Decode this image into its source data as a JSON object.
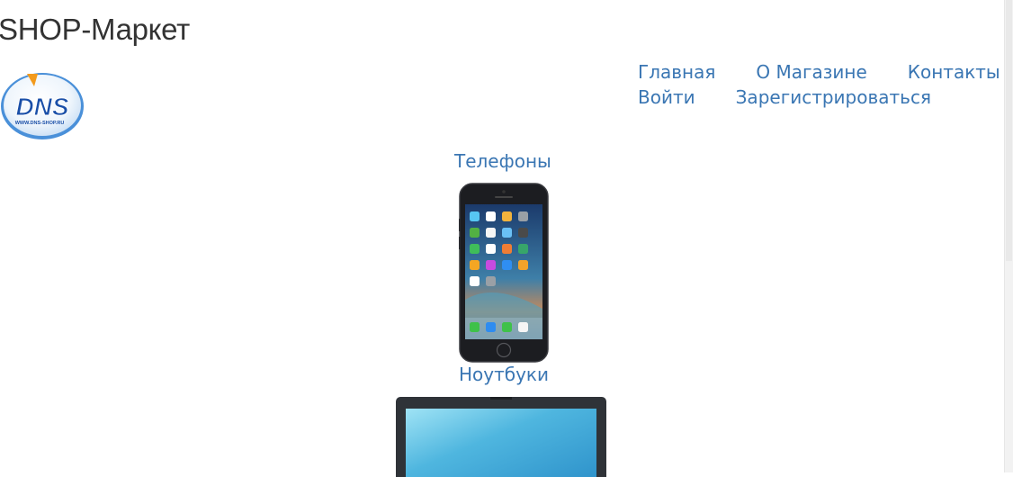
{
  "site": {
    "title": "SHOP-Маркет"
  },
  "logo": {
    "text": "DNS",
    "subtext": "WWW.DNS-SHOP.RU",
    "colors": {
      "blue": "#1a4fa8",
      "orange": "#f39a1c",
      "border": "#4a90d9"
    }
  },
  "nav": {
    "row1": [
      "Главная",
      "О Магазине",
      "Контакты"
    ],
    "row2": [
      "Войти",
      "Зарегистрироваться"
    ]
  },
  "categories": [
    {
      "label": "Телефоны",
      "image": "smartphone"
    },
    {
      "label": "Ноутбуки",
      "image": "laptop"
    }
  ],
  "colors": {
    "link": "#3a76b3",
    "title": "#333333"
  }
}
